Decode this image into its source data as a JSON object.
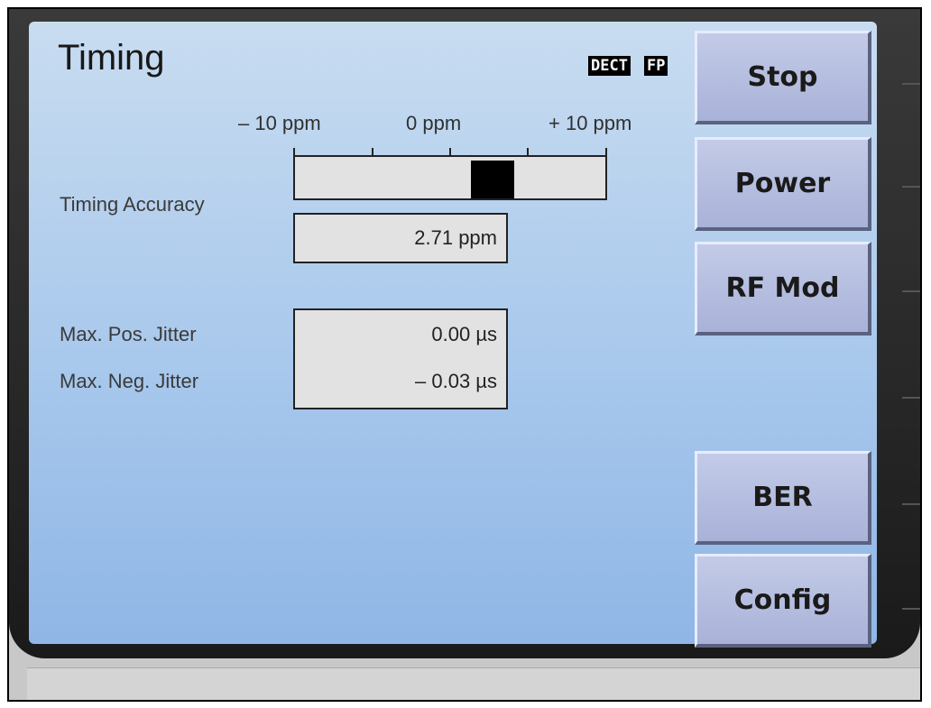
{
  "screen": {
    "title": "Timing",
    "badges": [
      "DECT",
      "FP"
    ]
  },
  "timing_accuracy": {
    "label": "Timing Accuracy",
    "scale_min_label": "– 10 ppm",
    "scale_mid_label": "0 ppm",
    "scale_max_label": "+ 10 ppm",
    "indicator_value_ppm": 2.71,
    "value_text": "2.71 ppm"
  },
  "jitter": {
    "pos_label": "Max. Pos. Jitter",
    "neg_label": "Max. Neg. Jitter",
    "pos_value": "0.00 µs",
    "neg_value": "– 0.03 µs"
  },
  "softkeys": {
    "stop": "Stop",
    "power": "Power",
    "rf_mod": "RF Mod",
    "ber": "BER",
    "config": "Config"
  },
  "colors": {
    "screen_bg": "#a8c8ec",
    "softkey_bg": "#b6bee0",
    "indicator": "#000000"
  }
}
